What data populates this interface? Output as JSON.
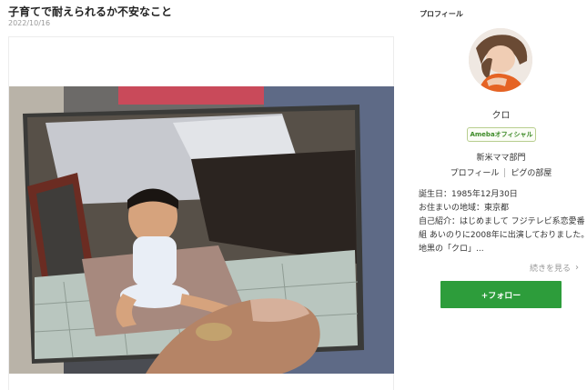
{
  "post": {
    "title": "子育てで耐えられるか不安なこと",
    "date": "2022/10/16"
  },
  "sidebar": {
    "heading": "プロフィール",
    "nickname": "クロ",
    "badge": "Amebaオフィシャル",
    "group": "新米ママ部門",
    "links": [
      "プロフィール",
      "ピグの部屋"
    ],
    "profile_lines": [
      "誕生日：1985年12月30日",
      "お住まいの地域：東京都",
      "自己紹介：はじめまして フジテレビ系恋愛番",
      "組 あいのりに2008年に出演しておりました。",
      "地黒の「クロ」..."
    ],
    "read_more": "続きを見る",
    "follow_label": "+フォロー",
    "colors": {
      "follow": "#2d9d3b",
      "badge_text": "#3c8a26"
    }
  }
}
